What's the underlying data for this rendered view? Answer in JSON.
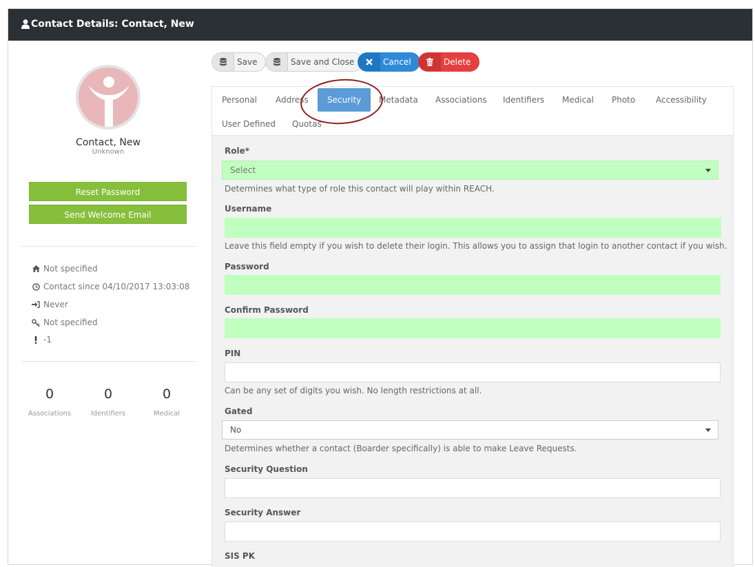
{
  "window": {
    "title": "Contact Details: Contact, New",
    "title_icon": "user-icon"
  },
  "profile": {
    "name": "Contact, New",
    "subtitle": "Unknown",
    "reset_password_label": "Reset Password",
    "send_welcome_label": "Send Welcome Email"
  },
  "info": [
    {
      "icon": "home-icon",
      "text": "Not specified"
    },
    {
      "icon": "clock-icon",
      "text": "Contact since 04/10/2017 13:03:08"
    },
    {
      "icon": "sign-in-icon",
      "text": "Never"
    },
    {
      "icon": "key-icon",
      "text": "Not specified"
    },
    {
      "icon": "exclamation-icon",
      "text": "-1"
    }
  ],
  "stats": [
    {
      "value": "0",
      "label": "Associations"
    },
    {
      "value": "0",
      "label": "Identifiers"
    },
    {
      "value": "0",
      "label": "Medical"
    }
  ],
  "toolbar": {
    "save_label": "Save",
    "save_close_label": "Save and Close",
    "cancel_label": "Cancel",
    "delete_label": "Delete"
  },
  "tabs": [
    {
      "label": "Personal"
    },
    {
      "label": "Address"
    },
    {
      "label": "Security",
      "active": true
    },
    {
      "label": "Metadata"
    },
    {
      "label": "Associations"
    },
    {
      "label": "Identifiers"
    },
    {
      "label": "Medical"
    },
    {
      "label": "Photo"
    },
    {
      "label": "Accessibility"
    },
    {
      "label": "User Defined"
    },
    {
      "label": "Quotas"
    }
  ],
  "form": {
    "role_label": "Role*",
    "role_value": "Select",
    "role_help": "Determines what type of role this contact will play within REACH.",
    "username_label": "Username",
    "username_help": "Leave this field empty if you wish to delete their login. This allows you to assign that login to another contact if you wish.",
    "password_label": "Password",
    "confirm_password_label": "Confirm Password",
    "pin_label": "PIN",
    "pin_help": "Can be any set of digits you wish. No length restrictions at all.",
    "gated_label": "Gated",
    "gated_value": "No",
    "gated_help": "Determines whether a contact (Boarder specifically) is able to make Leave Requests.",
    "security_question_label": "Security Question",
    "security_answer_label": "Security Answer",
    "sis_pk_label": "SIS PK"
  },
  "colors": {
    "titlebar": "#2b3034",
    "accent_green": "#86bf3c",
    "required_field": "#c0ffc0",
    "active_tab": "#5b9bd8",
    "cancel_blue": "#2e8ad8",
    "delete_red": "#e5403f",
    "annotation_ring": "#8f1d1d"
  }
}
